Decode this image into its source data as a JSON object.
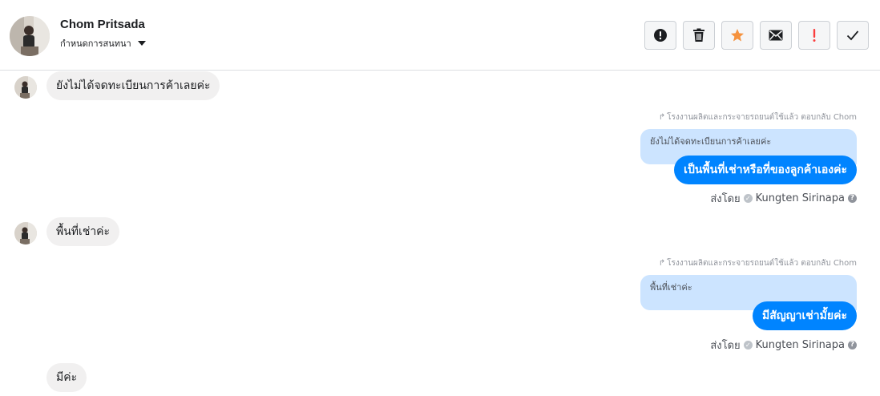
{
  "header": {
    "contact_name": "Chom Pritsada",
    "label_dropdown": "กำหนดการสนทนา"
  },
  "toolbar": {
    "buttons": [
      {
        "name": "report-spam",
        "icon": "exclamation-circle-icon",
        "color": "#1c1e21"
      },
      {
        "name": "delete",
        "icon": "trash-icon",
        "color": "#1c1e21"
      },
      {
        "name": "star",
        "icon": "star-icon",
        "color": "#f5923e"
      },
      {
        "name": "mark-unread",
        "icon": "envelope-icon",
        "color": "#1c1e21"
      },
      {
        "name": "follow-up",
        "icon": "exclamation-icon",
        "color": "#fa3e3e"
      },
      {
        "name": "mark-done",
        "icon": "checkmark-icon",
        "color": "#1c1e21"
      }
    ]
  },
  "messages": {
    "in_1": "ยังไม่ได้จดทะเบียนการค้าเลยค่ะ",
    "reply_1": {
      "meta": "โรงงานผลิตและกระจายรถยนต์ใช้แล้ว ตอบกลับ Chom",
      "quoted": "ยังไม่ได้จดทะเบียนการค้าเลยค่ะ",
      "text": "เป็นพื้นที่เช่าหรือที่ของลูกค้าเองค่ะ",
      "sent_by_label": "ส่งโดย",
      "sender": "Kungten Sirinapa"
    },
    "in_2": "พื้นที่เช่าค่ะ",
    "reply_2": {
      "meta": "โรงงานผลิตและกระจายรถยนต์ใช้แล้ว ตอบกลับ Chom",
      "quoted": "พื้นที่เช่าค่ะ",
      "text": "มีสัญญาเช่ามั้ยค่ะ",
      "sent_by_label": "ส่งโดย",
      "sender": "Kungten Sirinapa"
    },
    "in_3": "มีค่ะ"
  },
  "colors": {
    "outgoing_bubble": "#0084ff",
    "quoted_bubble": "#cce4ff",
    "incoming_bubble": "#f1f0f0"
  }
}
